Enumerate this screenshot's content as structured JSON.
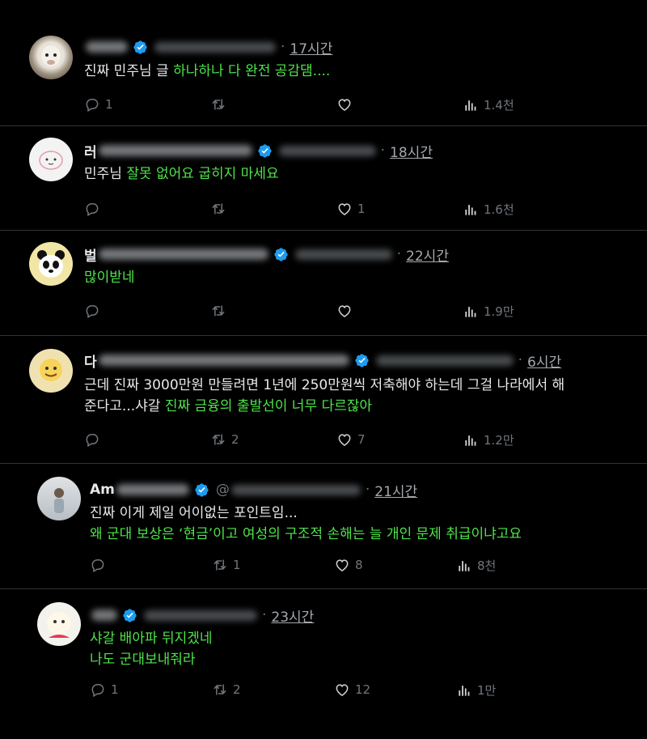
{
  "posts": [
    {
      "name_prefix": "",
      "time": "17시간",
      "text_plain": "진짜 민주님 글 ",
      "text_highlight": "하나하나 다 완전 공감댐....",
      "replies": "1",
      "reposts": "",
      "likes": "",
      "views": "1.4천"
    },
    {
      "name_prefix": "러",
      "time": "18시간",
      "text_plain": "민주님 ",
      "text_highlight": "잘못 없어요 굽히지 마세요",
      "replies": "",
      "reposts": "",
      "likes": "1",
      "views": "1.6천"
    },
    {
      "name_prefix": "벌",
      "time": "22시간",
      "text_plain": "",
      "text_highlight": "많이받네",
      "replies": "",
      "reposts": "",
      "likes": "",
      "views": "1.9만"
    },
    {
      "name_prefix": "다",
      "time": "6시간",
      "text_line1": "근데 진짜 3000만원 만들려면 1년에 250만원씩 저축해야 하는데 그걸 나라에서 해",
      "text_line2_plain": "준다고...샤갈 ",
      "text_line2_highlight": "진짜 금융의 출발선이 너무 다르잖아",
      "replies": "",
      "reposts": "2",
      "likes": "7",
      "views": "1.2만"
    },
    {
      "name_prefix": "Am",
      "handle_prefix": "@",
      "time": "21시간",
      "text_line1": "진짜 이게 제일 어이없는 포인트임...",
      "text_line2_highlight": "왜 군대 보상은 ‘현금’이고 여성의 구조적 손해는 늘 개인 문제 취급이냐고요",
      "replies": "",
      "reposts": "1",
      "likes": "8",
      "views": "8천"
    },
    {
      "name_prefix": "",
      "time": "23시간",
      "text_line1_highlight": "샤갈 배아파 뒤지겠네",
      "text_line2_highlight": "나도 군대보내줘라",
      "replies": "1",
      "reposts": "2",
      "likes": "12",
      "views": "1만"
    }
  ],
  "colors": {
    "background": "#000000",
    "text": "#e7e9ea",
    "muted": "#71767b",
    "highlight": "#4ee44a",
    "verified": "#1d9bf0",
    "divider": "#2f3336"
  }
}
